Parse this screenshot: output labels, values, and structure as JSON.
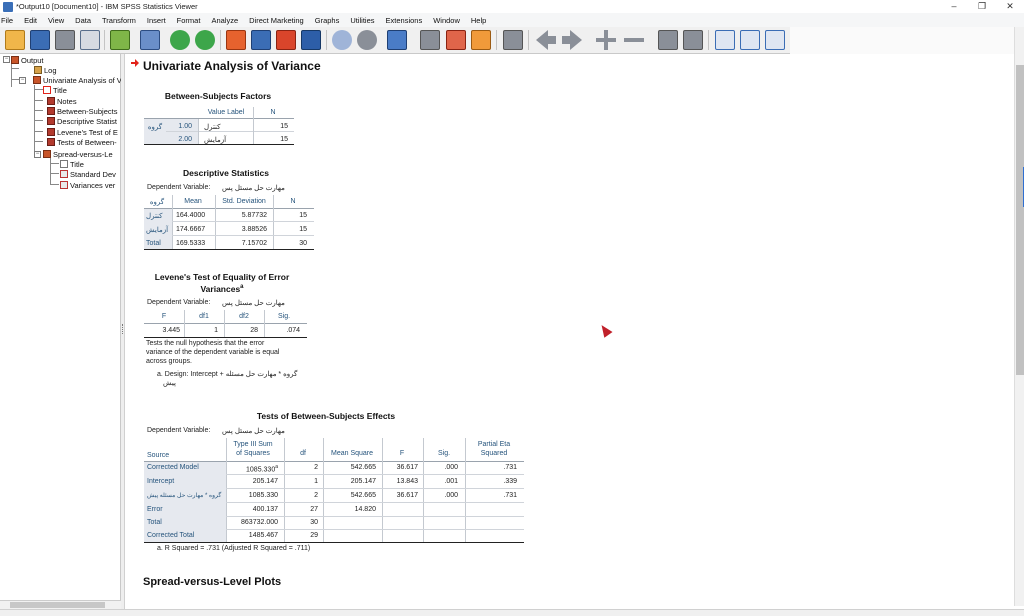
{
  "window": {
    "title": "*Output10 [Document10] - IBM SPSS Statistics Viewer",
    "buttons": [
      "–",
      "❐",
      "✕"
    ]
  },
  "menu": [
    "File",
    "Edit",
    "View",
    "Data",
    "Transform",
    "Insert",
    "Format",
    "Analyze",
    "Direct Marketing",
    "Graphs",
    "Utilities",
    "Extensions",
    "Window",
    "Help"
  ],
  "toolbar": {
    "icons": [
      "open-icon",
      "save-icon",
      "print-icon",
      "print-preview-icon",
      "export-icon",
      "recall-dialog-icon",
      "undo-icon",
      "redo-icon",
      "goto-data-icon",
      "goto-case-icon",
      "goto-variable-icon",
      "variables-icon",
      "circle-icon",
      "circles-icon",
      "list-icon",
      "build-icon",
      "edit-icon",
      "chart-icon",
      "blank-icon",
      "back-icon",
      "forward-icon",
      "expand-icon",
      "collapse-icon",
      "show-icon",
      "hide-icon",
      "insert-heading-icon",
      "insert-title-icon",
      "insert-text-icon"
    ]
  },
  "outline": {
    "items": [
      {
        "label": "Output"
      },
      {
        "label": "Log"
      },
      {
        "label": "Univariate Analysis of V"
      },
      {
        "label": "Title"
      },
      {
        "label": "Notes"
      },
      {
        "label": "Between-Subjects"
      },
      {
        "label": "Descriptive Statist"
      },
      {
        "label": "Levene's Test of E"
      },
      {
        "label": "Tests of Between-"
      },
      {
        "label": "Spread-versus-Le"
      },
      {
        "label": "Title"
      },
      {
        "label": "Standard Dev"
      },
      {
        "label": "Variances ver"
      }
    ]
  },
  "content": {
    "main_title": "Univariate Analysis of Variance",
    "bsf": {
      "title": "Between-Subjects Factors",
      "col_value_label": "Value Label",
      "col_n": "N",
      "row_var": "گروه",
      "rows": [
        {
          "value": "1.00",
          "label": "کنترل",
          "n": "15"
        },
        {
          "value": "2.00",
          "label": "آزمایش",
          "n": "15"
        }
      ]
    },
    "desc": {
      "title": "Descriptive Statistics",
      "dep_var_label": "Dependent Variable:",
      "dep_var": "مهارت حل مسئل پس",
      "headers": [
        "گروه",
        "Mean",
        "Std. Deviation",
        "N"
      ],
      "rows": [
        {
          "group": "کنترل",
          "mean": "164.4000",
          "sd": "5.87732",
          "n": "15"
        },
        {
          "group": "آزمایش",
          "mean": "174.6667",
          "sd": "3.88526",
          "n": "15"
        },
        {
          "group": "Total",
          "mean": "169.5333",
          "sd": "7.15702",
          "n": "30"
        }
      ]
    },
    "levene": {
      "title_line1": "Levene's Test of Equality of Error",
      "title_line2": "Variances",
      "superscript": "a",
      "dep_var_label": "Dependent Variable:",
      "dep_var": "مهارت حل مسئل پس",
      "headers": [
        "F",
        "df1",
        "df2",
        "Sig."
      ],
      "values": [
        "3.445",
        "1",
        "28",
        ".074"
      ],
      "note_line1": "Tests the null hypothesis that the error",
      "note_line2": "variance of the dependent variable is equal",
      "note_line3": "across groups.",
      "footnote_line1": "a. Design: Intercept + گروه * مهارت حل مسئله",
      "footnote_line2": "پیش"
    },
    "tbse": {
      "title": "Tests of Between-Subjects Effects",
      "dep_var_label": "Dependent Variable:",
      "dep_var": "مهارت حل مسئل پس",
      "headers": {
        "source": "Source",
        "ss_line1": "Type III Sum",
        "ss_line2": "of Squares",
        "df": "df",
        "ms": "Mean Square",
        "f": "F",
        "sig": "Sig.",
        "eta_line1": "Partial Eta",
        "eta_line2": "Squared"
      },
      "rows": [
        {
          "source": "Corrected Model",
          "ss": "1085.330",
          "sup": "a",
          "df": "2",
          "ms": "542.665",
          "f": "36.617",
          "sig": ".000",
          "eta": ".731"
        },
        {
          "source": "Intercept",
          "ss": "205.147",
          "sup": "",
          "df": "1",
          "ms": "205.147",
          "f": "13.843",
          "sig": ".001",
          "eta": ".339"
        },
        {
          "source": "گروه * مهارت حل مسئله پیش",
          "ss": "1085.330",
          "sup": "",
          "df": "2",
          "ms": "542.665",
          "f": "36.617",
          "sig": ".000",
          "eta": ".731"
        },
        {
          "source": "Error",
          "ss": "400.137",
          "sup": "",
          "df": "27",
          "ms": "14.820",
          "f": "",
          "sig": "",
          "eta": ""
        },
        {
          "source": "Total",
          "ss": "863732.000",
          "sup": "",
          "df": "30",
          "ms": "",
          "f": "",
          "sig": "",
          "eta": ""
        },
        {
          "source": "Corrected Total",
          "ss": "1485.467",
          "sup": "",
          "df": "29",
          "ms": "",
          "f": "",
          "sig": "",
          "eta": ""
        }
      ],
      "footnote": "a. R Squared = .731 (Adjusted R Squared = .711)"
    },
    "spread_title": "Spread-versus-Level Plots"
  },
  "colors": {
    "accent_red": "#e2231a",
    "table_label_blue": "#26547c",
    "row_bg": "#e6e9ef"
  }
}
